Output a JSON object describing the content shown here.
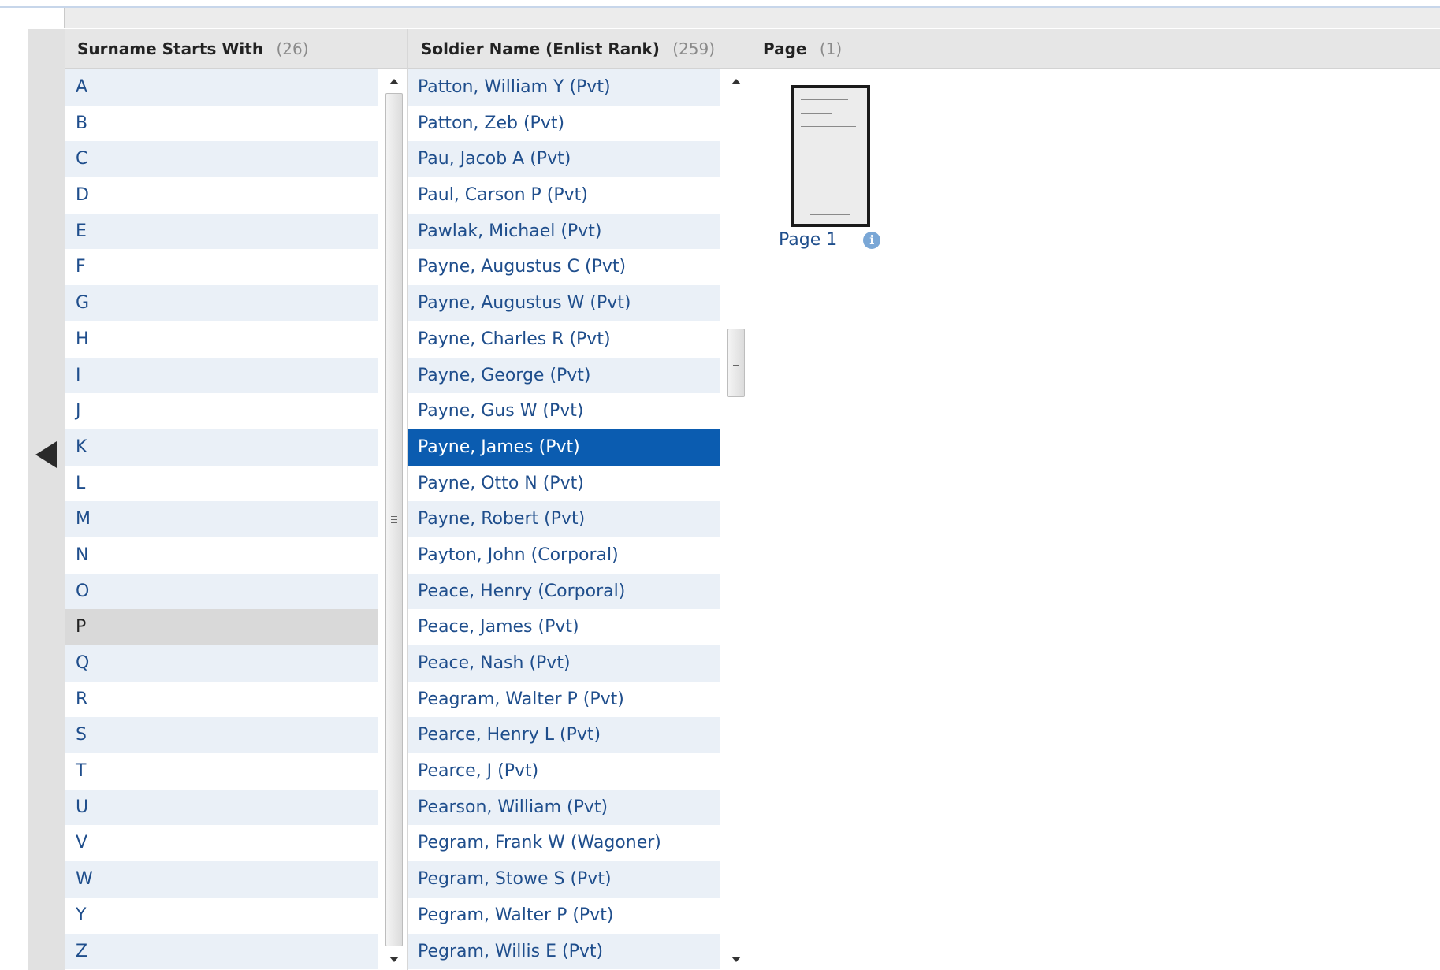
{
  "columns": {
    "surname": {
      "title": "Surname Starts With",
      "count": "(26)",
      "items": [
        "A",
        "B",
        "C",
        "D",
        "E",
        "F",
        "G",
        "H",
        "I",
        "J",
        "K",
        "L",
        "M",
        "N",
        "O",
        "P",
        "Q",
        "R",
        "S",
        "T",
        "U",
        "V",
        "W",
        "Y",
        "Z"
      ],
      "active": "P"
    },
    "soldier": {
      "title": "Soldier Name (Enlist Rank)",
      "count": "(259)",
      "items": [
        "Patton, William Y (Pvt)",
        "Patton, Zeb (Pvt)",
        "Pau, Jacob A (Pvt)",
        "Paul, Carson P (Pvt)",
        "Pawlak, Michael (Pvt)",
        "Payne, Augustus C (Pvt)",
        "Payne, Augustus W (Pvt)",
        "Payne, Charles R (Pvt)",
        "Payne, George (Pvt)",
        "Payne, Gus W (Pvt)",
        "Payne, James (Pvt)",
        "Payne, Otto N (Pvt)",
        "Payne, Robert (Pvt)",
        "Payton, John (Corporal)",
        "Peace, Henry (Corporal)",
        "Peace, James (Pvt)",
        "Peace, Nash (Pvt)",
        "Peagram, Walter P (Pvt)",
        "Pearce, Henry L (Pvt)",
        "Pearce, J (Pvt)",
        "Pearson, William (Pvt)",
        "Pegram, Frank W (Wagoner)",
        "Pegram, Stowe S (Pvt)",
        "Pegram, Walter P (Pvt)",
        "Pegram, Willis E (Pvt)"
      ],
      "selected": "Payne, James (Pvt)"
    },
    "page": {
      "title": "Page",
      "count": "(1)",
      "thumb_label": "Page 1",
      "info_icon": "info-icon"
    }
  },
  "scroll": {
    "surname_thumb_fraction": 1.0,
    "soldier_thumb_fraction": 0.08,
    "soldier_thumb_offset_fraction": 0.3
  }
}
